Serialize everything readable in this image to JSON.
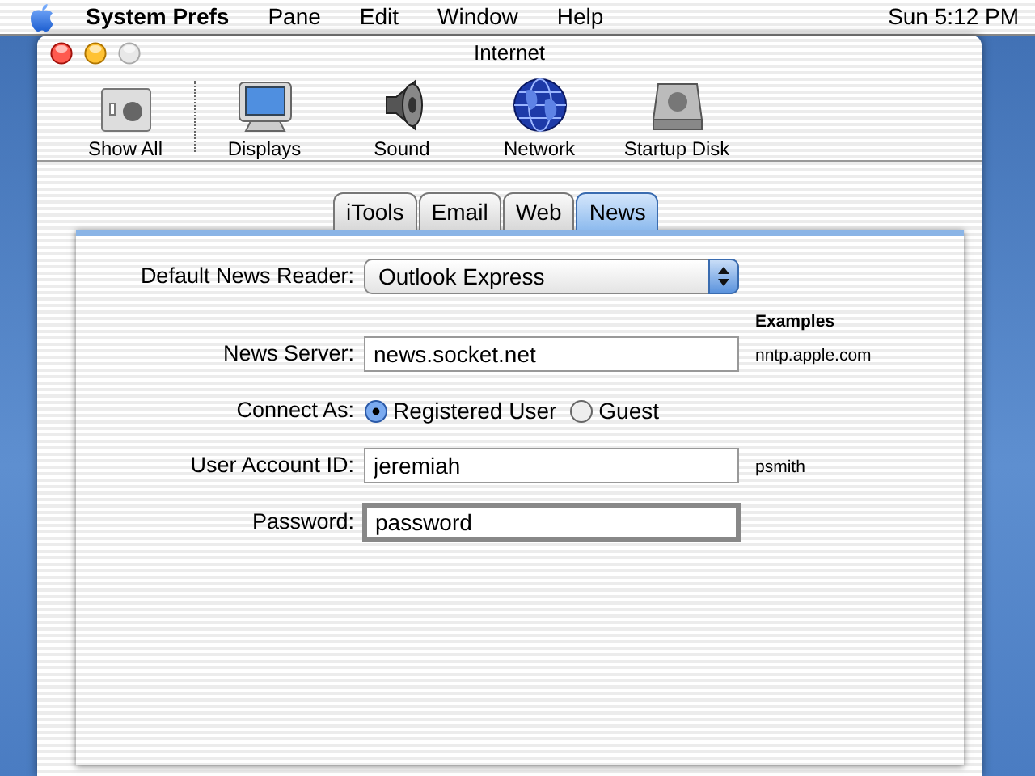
{
  "menu_bar": {
    "app_name": "System Prefs",
    "items": [
      "Pane",
      "Edit",
      "Window",
      "Help"
    ],
    "clock": "Sun 5:12 PM"
  },
  "window": {
    "title": "Internet"
  },
  "toolbar": [
    {
      "label": "Show All"
    },
    {
      "label": "Displays"
    },
    {
      "label": "Sound"
    },
    {
      "label": "Network"
    },
    {
      "label": "Startup Disk"
    }
  ],
  "tabs": [
    {
      "label": "iTools",
      "selected": false
    },
    {
      "label": "Email",
      "selected": false
    },
    {
      "label": "Web",
      "selected": false
    },
    {
      "label": "News",
      "selected": true
    }
  ],
  "form": {
    "news_reader": {
      "label": "Default News Reader:",
      "value": "Outlook Express"
    },
    "examples_heading": "Examples",
    "news_server": {
      "label": "News Server:",
      "value": "news.socket.net",
      "example": "nntp.apple.com",
      "focused": false
    },
    "connect_as": {
      "label": "Connect As:",
      "options": [
        {
          "label": "Registered User",
          "selected": true
        },
        {
          "label": "Guest",
          "selected": false
        }
      ]
    },
    "user_account_id": {
      "label": "User Account ID:",
      "value": "jeremiah",
      "example": "psmith",
      "focused": false
    },
    "password": {
      "label": "Password:",
      "value": "password",
      "focused": true
    }
  }
}
